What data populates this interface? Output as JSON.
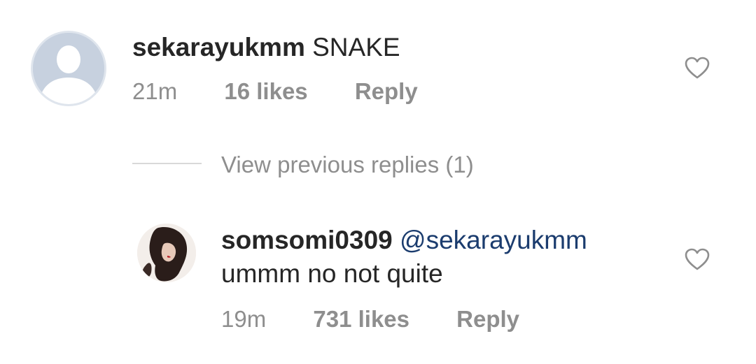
{
  "comment": {
    "username": "sekarayukmm",
    "text": "SNAKE",
    "time": "21m",
    "likes": "16 likes",
    "reply_label": "Reply",
    "avatar_icon": "default-user-avatar-icon",
    "like_icon": "heart-outline-icon"
  },
  "thread": {
    "view_previous": "View previous replies (1)"
  },
  "reply": {
    "username": "somsomi0309",
    "mention": "@sekarayukmm",
    "text": "ummm no not quite",
    "time": "19m",
    "likes": "731 likes",
    "reply_label": "Reply",
    "like_icon": "heart-outline-icon"
  },
  "colors": {
    "text": "#262626",
    "secondary": "#8e8e8e",
    "mention": "#1b3c6e",
    "default_avatar": "#c7d1df"
  }
}
